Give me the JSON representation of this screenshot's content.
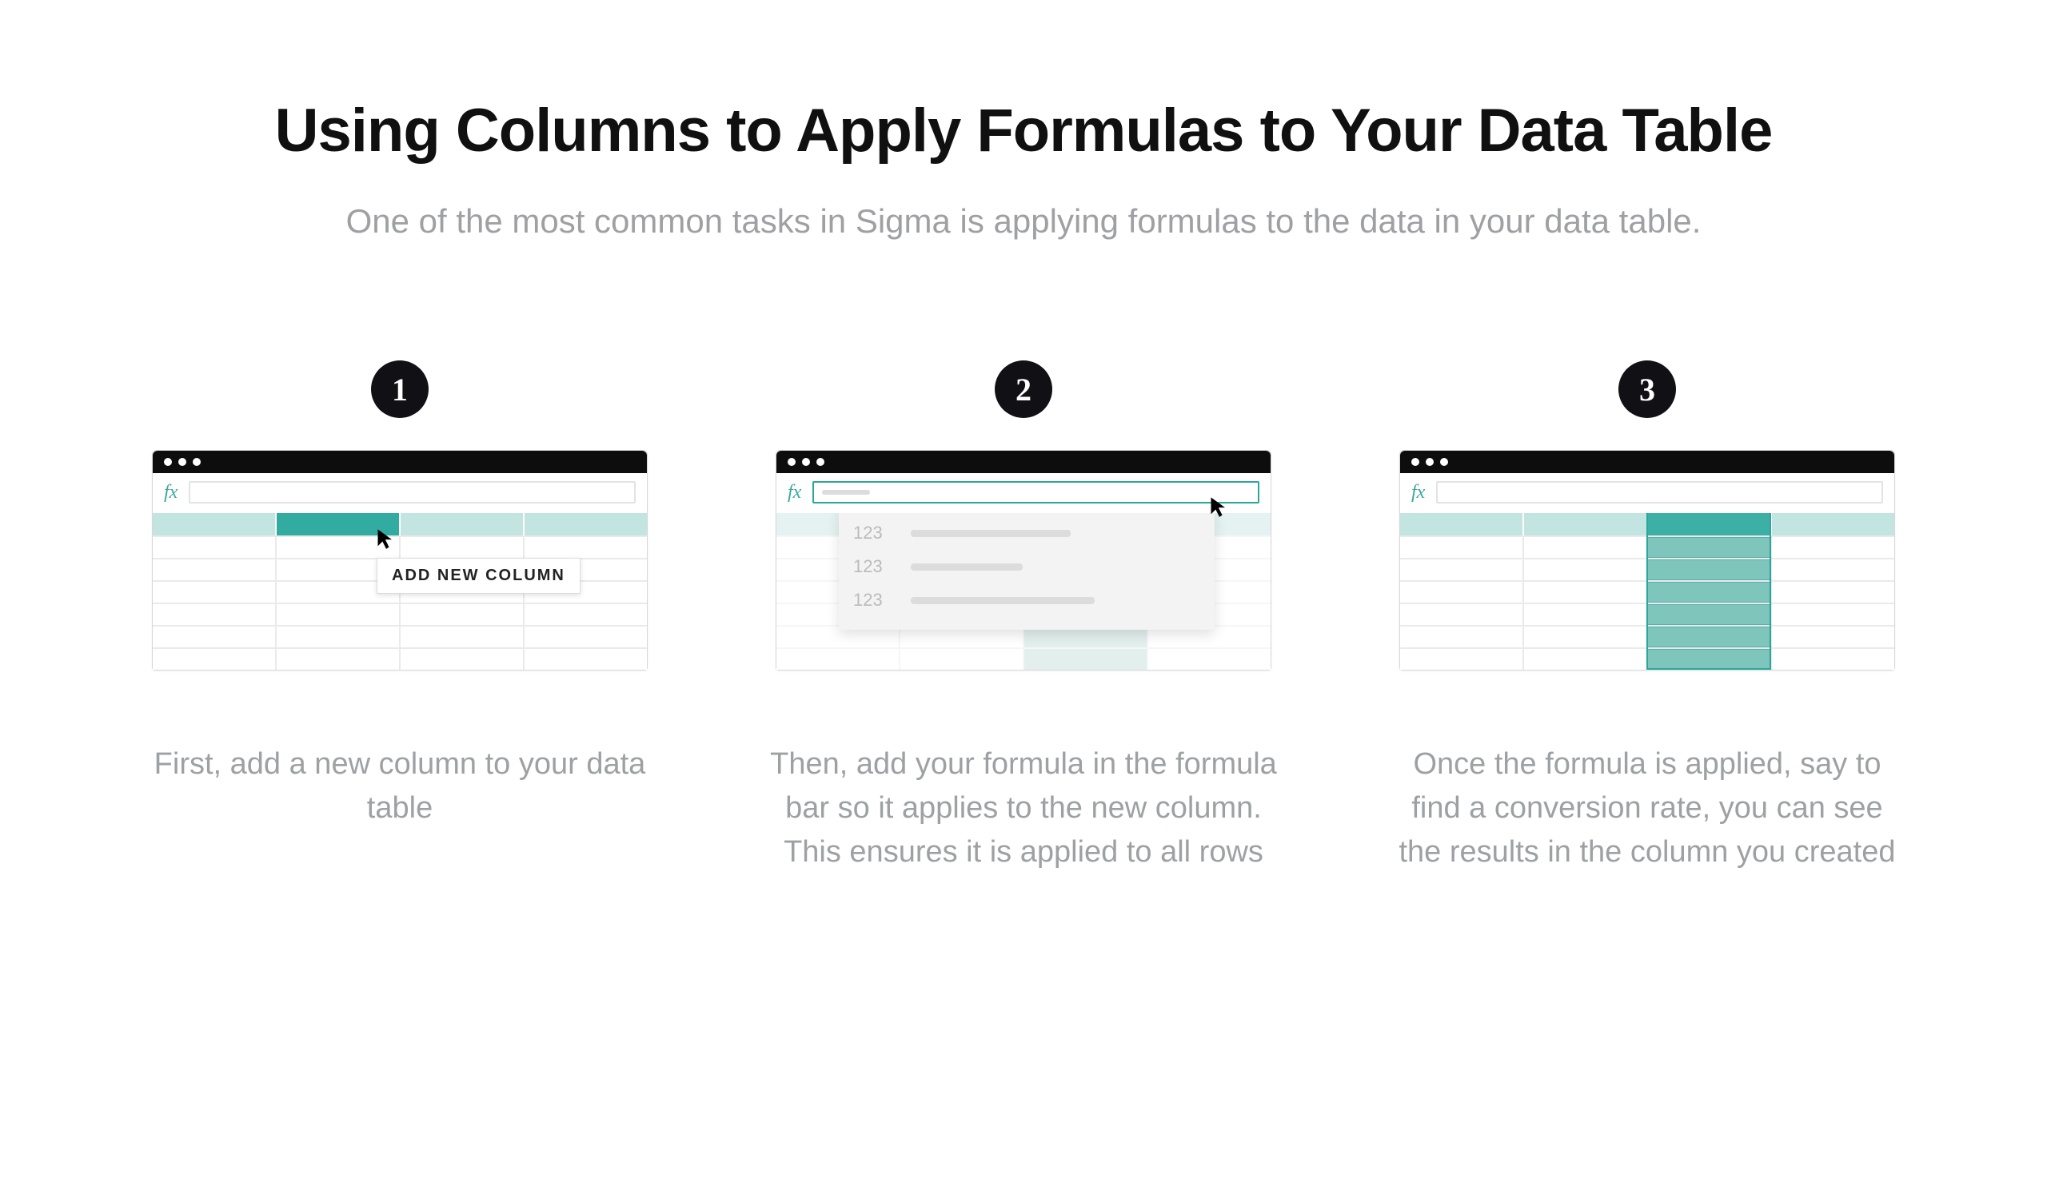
{
  "title": "Using Columns to Apply Formulas to Your Data Table",
  "subtitle": "One of the most common tasks in Sigma is applying formulas to the data in your data table.",
  "fx_label": "fx",
  "steps": [
    {
      "number": "1",
      "caption": "First, add a new column to your data table",
      "tooltip": "ADD NEW COLUMN"
    },
    {
      "number": "2",
      "caption": "Then, add your formula in the formula bar so it applies to the new column. This ensures it is applied to all rows",
      "autocomplete_numbers": [
        "123",
        "123",
        "123"
      ]
    },
    {
      "number": "3",
      "caption": "Once the formula is applied, say to find a conversion rate, you can see the results in the column you created"
    }
  ]
}
